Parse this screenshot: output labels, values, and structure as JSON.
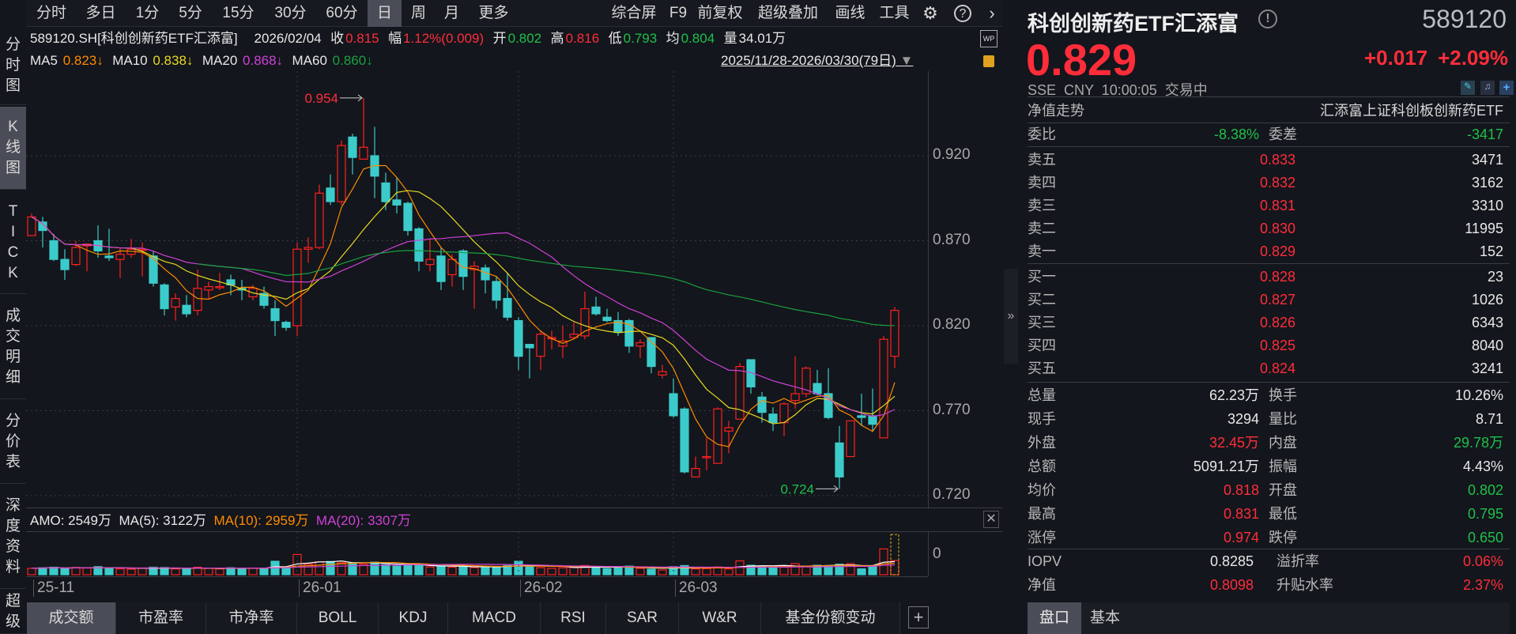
{
  "toolbar": {
    "periods": [
      "分时",
      "多日",
      "1分",
      "5分",
      "15分",
      "30分",
      "60分",
      "日",
      "周",
      "月",
      "更多"
    ],
    "selected_period": "日",
    "tools": [
      "综合屏",
      "F9",
      "前复权",
      "超级叠加",
      "画线",
      "工具"
    ],
    "icons": [
      "gear-icon",
      "help-icon",
      "chevron-right-icon"
    ]
  },
  "sidebar": {
    "items": [
      [
        "分",
        "时",
        "图"
      ],
      [
        "K",
        "线",
        "图"
      ],
      [
        "T",
        "I",
        "C",
        "K"
      ],
      [
        "成",
        "交",
        "明",
        "细"
      ],
      [
        "分",
        "价",
        "表"
      ],
      [
        "深",
        "度",
        "资",
        "料"
      ],
      [
        "超",
        "级"
      ]
    ],
    "selected": 1
  },
  "info": {
    "code": "589120.SH[科创创新药ETF汇添富]",
    "date": "2026/02/04",
    "close_label": "收",
    "close": "0.815",
    "chg_label": "幅",
    "chg": "1.12%(0.009)",
    "open_label": "开",
    "open": "0.802",
    "high_label": "高",
    "high": "0.816",
    "low_label": "低",
    "low": "0.793",
    "avg_label": "均",
    "avg": "0.804",
    "vol_label": "量",
    "vol": "34.01万"
  },
  "ma": {
    "ma5_label": "MA5",
    "ma5": "0.823↓",
    "ma10_label": "MA10",
    "ma10": "0.838↓",
    "ma20_label": "MA20",
    "ma20": "0.868↓",
    "ma60_label": "MA60",
    "ma60": "0.860↓",
    "range": "2025/11/28-2026/03/30(79日)"
  },
  "colors": {
    "up": "#ff2020",
    "down": "#3ccbcb",
    "ma5": "#ff8a00",
    "ma10": "#e8d820",
    "ma20": "#d040d8",
    "ma60": "#1aa040",
    "bg": "#13161c",
    "grid": "#3a3d45"
  },
  "chart_data": {
    "type": "candlestick",
    "y_ticks": [
      "0.920",
      "0.870",
      "0.820",
      "0.770",
      "0.720"
    ],
    "ylim": [
      0.715,
      0.97
    ],
    "max_label": "0.954",
    "min_label": "0.724",
    "month_labels": [
      {
        "label": "25-11",
        "index": 0
      },
      {
        "label": "26-01",
        "index": 24
      },
      {
        "label": "26-02",
        "index": 44
      },
      {
        "label": "26-03",
        "index": 58
      }
    ],
    "ohlc": [
      [
        0.873,
        0.886,
        0.873,
        0.884
      ],
      [
        0.881,
        0.884,
        0.866,
        0.876
      ],
      [
        0.87,
        0.874,
        0.858,
        0.859
      ],
      [
        0.859,
        0.865,
        0.847,
        0.853
      ],
      [
        0.856,
        0.87,
        0.855,
        0.866
      ],
      [
        0.867,
        0.868,
        0.852,
        0.868
      ],
      [
        0.87,
        0.879,
        0.86,
        0.864
      ],
      [
        0.861,
        0.877,
        0.858,
        0.86
      ],
      [
        0.859,
        0.866,
        0.848,
        0.862
      ],
      [
        0.862,
        0.871,
        0.86,
        0.865
      ],
      [
        0.865,
        0.869,
        0.849,
        0.865
      ],
      [
        0.861,
        0.864,
        0.843,
        0.845
      ],
      [
        0.844,
        0.845,
        0.826,
        0.83
      ],
      [
        0.831,
        0.839,
        0.823,
        0.836
      ],
      [
        0.832,
        0.838,
        0.825,
        0.827
      ],
      [
        0.829,
        0.853,
        0.826,
        0.842
      ],
      [
        0.841,
        0.846,
        0.836,
        0.843
      ],
      [
        0.843,
        0.851,
        0.841,
        0.843
      ],
      [
        0.847,
        0.85,
        0.838,
        0.844
      ],
      [
        0.842,
        0.847,
        0.835,
        0.841
      ],
      [
        0.837,
        0.844,
        0.835,
        0.842
      ],
      [
        0.839,
        0.843,
        0.83,
        0.832
      ],
      [
        0.83,
        0.835,
        0.814,
        0.823
      ],
      [
        0.822,
        0.823,
        0.817,
        0.819
      ],
      [
        0.82,
        0.869,
        0.814,
        0.865
      ],
      [
        0.865,
        0.872,
        0.857,
        0.866
      ],
      [
        0.866,
        0.903,
        0.865,
        0.898
      ],
      [
        0.901,
        0.909,
        0.891,
        0.893
      ],
      [
        0.893,
        0.929,
        0.891,
        0.926
      ],
      [
        0.931,
        0.933,
        0.909,
        0.919
      ],
      [
        0.918,
        0.954,
        0.918,
        0.925
      ],
      [
        0.92,
        0.937,
        0.895,
        0.908
      ],
      [
        0.904,
        0.91,
        0.888,
        0.893
      ],
      [
        0.894,
        0.907,
        0.886,
        0.891
      ],
      [
        0.892,
        0.893,
        0.873,
        0.876
      ],
      [
        0.877,
        0.878,
        0.852,
        0.858
      ],
      [
        0.856,
        0.871,
        0.852,
        0.859
      ],
      [
        0.861,
        0.866,
        0.841,
        0.846
      ],
      [
        0.85,
        0.862,
        0.843,
        0.859
      ],
      [
        0.864,
        0.865,
        0.841,
        0.849
      ],
      [
        0.853,
        0.858,
        0.83,
        0.855
      ],
      [
        0.854,
        0.856,
        0.839,
        0.847
      ],
      [
        0.846,
        0.849,
        0.83,
        0.835
      ],
      [
        0.836,
        0.851,
        0.823,
        0.825
      ],
      [
        0.823,
        0.825,
        0.794,
        0.802
      ],
      [
        0.809,
        0.809,
        0.789,
        0.807
      ],
      [
        0.802,
        0.817,
        0.794,
        0.815
      ],
      [
        0.813,
        0.817,
        0.806,
        0.813
      ],
      [
        0.808,
        0.82,
        0.801,
        0.811
      ],
      [
        0.813,
        0.822,
        0.812,
        0.815
      ],
      [
        0.814,
        0.84,
        0.812,
        0.83
      ],
      [
        0.831,
        0.837,
        0.826,
        0.827
      ],
      [
        0.825,
        0.83,
        0.822,
        0.823
      ],
      [
        0.823,
        0.828,
        0.814,
        0.816
      ],
      [
        0.823,
        0.824,
        0.804,
        0.808
      ],
      [
        0.808,
        0.812,
        0.801,
        0.81
      ],
      [
        0.813,
        0.813,
        0.792,
        0.796
      ],
      [
        0.791,
        0.797,
        0.789,
        0.793
      ],
      [
        0.78,
        0.789,
        0.766,
        0.767
      ],
      [
        0.771,
        0.772,
        0.733,
        0.734
      ],
      [
        0.731,
        0.743,
        0.731,
        0.736
      ],
      [
        0.743,
        0.754,
        0.735,
        0.743
      ],
      [
        0.739,
        0.772,
        0.739,
        0.771
      ],
      [
        0.758,
        0.764,
        0.745,
        0.76
      ],
      [
        0.765,
        0.798,
        0.765,
        0.796
      ],
      [
        0.8,
        0.8,
        0.78,
        0.784
      ],
      [
        0.778,
        0.781,
        0.763,
        0.769
      ],
      [
        0.768,
        0.772,
        0.758,
        0.763
      ],
      [
        0.763,
        0.775,
        0.755,
        0.774
      ],
      [
        0.776,
        0.802,
        0.771,
        0.78
      ],
      [
        0.78,
        0.796,
        0.778,
        0.795
      ],
      [
        0.786,
        0.794,
        0.779,
        0.78
      ],
      [
        0.78,
        0.795,
        0.765,
        0.766
      ],
      [
        0.751,
        0.761,
        0.724,
        0.731
      ],
      [
        0.743,
        0.764,
        0.743,
        0.764
      ],
      [
        0.767,
        0.78,
        0.761,
        0.766
      ],
      [
        0.767,
        0.783,
        0.758,
        0.762
      ],
      [
        0.754,
        0.814,
        0.754,
        0.812
      ],
      [
        0.802,
        0.831,
        0.795,
        0.829
      ]
    ]
  },
  "amo_chart": {
    "header": {
      "amo": "AMO: 2549万",
      "ma5": "MA(5): 3122万",
      "ma10": "MA(10): 2959万",
      "ma20": "MA(20): 3307万"
    },
    "y_tick": "0",
    "unit": "万",
    "amounts": [
      2300,
      2500,
      2700,
      2200,
      2600,
      2400,
      2900,
      2500,
      2100,
      2000,
      2300,
      2700,
      2600,
      2100,
      2000,
      2700,
      2300,
      2100,
      2500,
      2200,
      2400,
      2300,
      4850,
      2600,
      7300,
      3800,
      4600,
      4750,
      4300,
      4200,
      3800,
      4500,
      3700,
      3100,
      3400,
      3600,
      2800,
      3000,
      2700,
      3200,
      2600,
      2900,
      2700,
      3300,
      4850,
      3000,
      2549,
      2300,
      2500,
      2700,
      3300,
      2800,
      2200,
      2600,
      3100,
      2300,
      2000,
      1700,
      2900,
      3300,
      2100,
      2200,
      2800,
      2100,
      5000,
      3400,
      3000,
      2600,
      2700,
      4000,
      3100,
      3400,
      3300,
      3800,
      4000,
      2100,
      3200,
      9300,
      5091
    ],
    "projected_last": 14500
  },
  "bottom_tabs": [
    "成交额",
    "市盈率",
    "市净率",
    "BOLL",
    "KDJ",
    "MACD",
    "RSI",
    "SAR",
    "W&R",
    "基金份额变动"
  ],
  "bottom_selected": 0,
  "right": {
    "name": "科创创新药ETF汇添富",
    "code": "589120",
    "price": "0.829",
    "change": "+0.017",
    "pct": "+2.09%",
    "meta": "SSE  CNY  10:00:05  交易中",
    "nav_trend": "净值走势",
    "fund_name": "汇添富上证科创板创新药ETF",
    "weibi_label": "委比",
    "weibi": "-8.38%",
    "weicha_label": "委差",
    "weicha": "-3417",
    "asks": [
      [
        "卖五",
        "0.833",
        "3471"
      ],
      [
        "卖四",
        "0.832",
        "3162"
      ],
      [
        "卖三",
        "0.831",
        "3310"
      ],
      [
        "卖二",
        "0.830",
        "11995"
      ],
      [
        "卖一",
        "0.829",
        "152"
      ]
    ],
    "bids": [
      [
        "买一",
        "0.828",
        "23"
      ],
      [
        "买二",
        "0.827",
        "1026"
      ],
      [
        "买三",
        "0.826",
        "6343"
      ],
      [
        "买四",
        "0.825",
        "8040"
      ],
      [
        "买五",
        "0.824",
        "3241"
      ]
    ],
    "stats": [
      [
        "总量",
        "62.23万",
        "white",
        "换手",
        "10.26%",
        "white"
      ],
      [
        "现手",
        "3294",
        "white",
        "量比",
        "8.71",
        "white"
      ],
      [
        "外盘",
        "32.45万",
        "red",
        "内盘",
        "29.78万",
        "green"
      ],
      [
        "总额",
        "5091.21万",
        "white",
        "振幅",
        "4.43%",
        "white"
      ],
      [
        "均价",
        "0.818",
        "red",
        "开盘",
        "0.802",
        "green"
      ],
      [
        "最高",
        "0.831",
        "red",
        "最低",
        "0.795",
        "green"
      ],
      [
        "涨停",
        "0.974",
        "red",
        "跌停",
        "0.650",
        "green"
      ]
    ],
    "stats2": [
      [
        "IOPV",
        "0.8285",
        "white",
        "溢折率",
        "0.06%",
        "red"
      ],
      [
        "净值",
        "0.8098",
        "red",
        "升贴水率",
        "2.37%",
        "red"
      ]
    ],
    "tabs": [
      "盘口",
      "基本"
    ]
  }
}
